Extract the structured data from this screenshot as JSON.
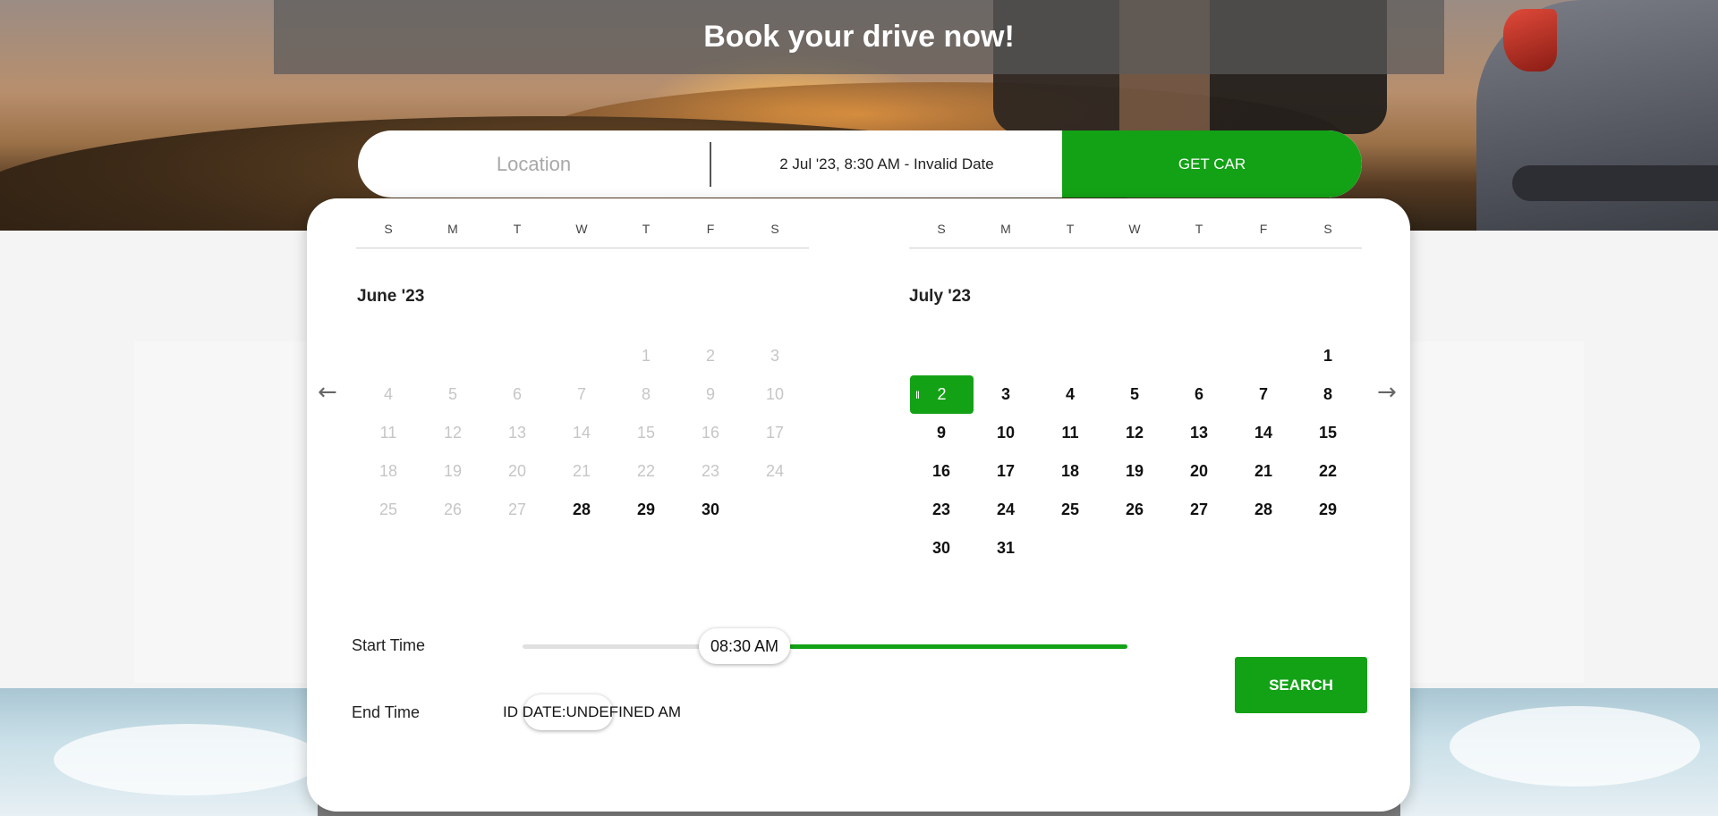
{
  "header": {
    "title": "Book your drive now!"
  },
  "search_bar": {
    "location_placeholder": "Location",
    "date_range": "2 Jul '23, 8:30 AM - Invalid Date",
    "get_car_label": "GET CAR"
  },
  "calendar": {
    "weekdays": [
      "S",
      "M",
      "T",
      "W",
      "T",
      "F",
      "S"
    ],
    "left": {
      "title": "June '23",
      "days": [
        {
          "d": "",
          "s": "empty"
        },
        {
          "d": "",
          "s": "empty"
        },
        {
          "d": "",
          "s": "empty"
        },
        {
          "d": "",
          "s": "empty"
        },
        {
          "d": "1",
          "s": "dim"
        },
        {
          "d": "2",
          "s": "dim"
        },
        {
          "d": "3",
          "s": "dim"
        },
        {
          "d": "4",
          "s": "dim"
        },
        {
          "d": "5",
          "s": "dim"
        },
        {
          "d": "6",
          "s": "dim"
        },
        {
          "d": "7",
          "s": "dim"
        },
        {
          "d": "8",
          "s": "dim"
        },
        {
          "d": "9",
          "s": "dim"
        },
        {
          "d": "10",
          "s": "dim"
        },
        {
          "d": "11",
          "s": "dim"
        },
        {
          "d": "12",
          "s": "dim"
        },
        {
          "d": "13",
          "s": "dim"
        },
        {
          "d": "14",
          "s": "dim"
        },
        {
          "d": "15",
          "s": "dim"
        },
        {
          "d": "16",
          "s": "dim"
        },
        {
          "d": "17",
          "s": "dim"
        },
        {
          "d": "18",
          "s": "dim"
        },
        {
          "d": "19",
          "s": "dim"
        },
        {
          "d": "20",
          "s": "dim"
        },
        {
          "d": "21",
          "s": "dim"
        },
        {
          "d": "22",
          "s": "dim"
        },
        {
          "d": "23",
          "s": "dim"
        },
        {
          "d": "24",
          "s": "dim"
        },
        {
          "d": "25",
          "s": "dim"
        },
        {
          "d": "26",
          "s": "dim"
        },
        {
          "d": "27",
          "s": "dim"
        },
        {
          "d": "28",
          "s": "act"
        },
        {
          "d": "29",
          "s": "act"
        },
        {
          "d": "30",
          "s": "act"
        }
      ]
    },
    "right": {
      "title": "July '23",
      "days": [
        {
          "d": "",
          "s": "empty"
        },
        {
          "d": "",
          "s": "empty"
        },
        {
          "d": "",
          "s": "empty"
        },
        {
          "d": "",
          "s": "empty"
        },
        {
          "d": "",
          "s": "empty"
        },
        {
          "d": "",
          "s": "empty"
        },
        {
          "d": "1",
          "s": "act"
        },
        {
          "d": "2",
          "s": "sel"
        },
        {
          "d": "3",
          "s": "act"
        },
        {
          "d": "4",
          "s": "act"
        },
        {
          "d": "5",
          "s": "act"
        },
        {
          "d": "6",
          "s": "act"
        },
        {
          "d": "7",
          "s": "act"
        },
        {
          "d": "8",
          "s": "act"
        },
        {
          "d": "9",
          "s": "act"
        },
        {
          "d": "10",
          "s": "act"
        },
        {
          "d": "11",
          "s": "act"
        },
        {
          "d": "12",
          "s": "act"
        },
        {
          "d": "13",
          "s": "act"
        },
        {
          "d": "14",
          "s": "act"
        },
        {
          "d": "15",
          "s": "act"
        },
        {
          "d": "16",
          "s": "act"
        },
        {
          "d": "17",
          "s": "act"
        },
        {
          "d": "18",
          "s": "act"
        },
        {
          "d": "19",
          "s": "act"
        },
        {
          "d": "20",
          "s": "act"
        },
        {
          "d": "21",
          "s": "act"
        },
        {
          "d": "22",
          "s": "act"
        },
        {
          "d": "23",
          "s": "act"
        },
        {
          "d": "24",
          "s": "act"
        },
        {
          "d": "25",
          "s": "act"
        },
        {
          "d": "26",
          "s": "act"
        },
        {
          "d": "27",
          "s": "act"
        },
        {
          "d": "28",
          "s": "act"
        },
        {
          "d": "29",
          "s": "act"
        },
        {
          "d": "30",
          "s": "act"
        },
        {
          "d": "31",
          "s": "act"
        }
      ]
    },
    "prev_icon": "arrow-left-icon",
    "next_icon": "arrow-right-icon"
  },
  "time": {
    "start_label": "Start Time",
    "start_value": "08:30 AM",
    "end_label": "End Time",
    "end_value": "ID DATE:UNDEFINED AM"
  },
  "search_button_label": "SEARCH",
  "colors": {
    "accent": "#13a216"
  }
}
